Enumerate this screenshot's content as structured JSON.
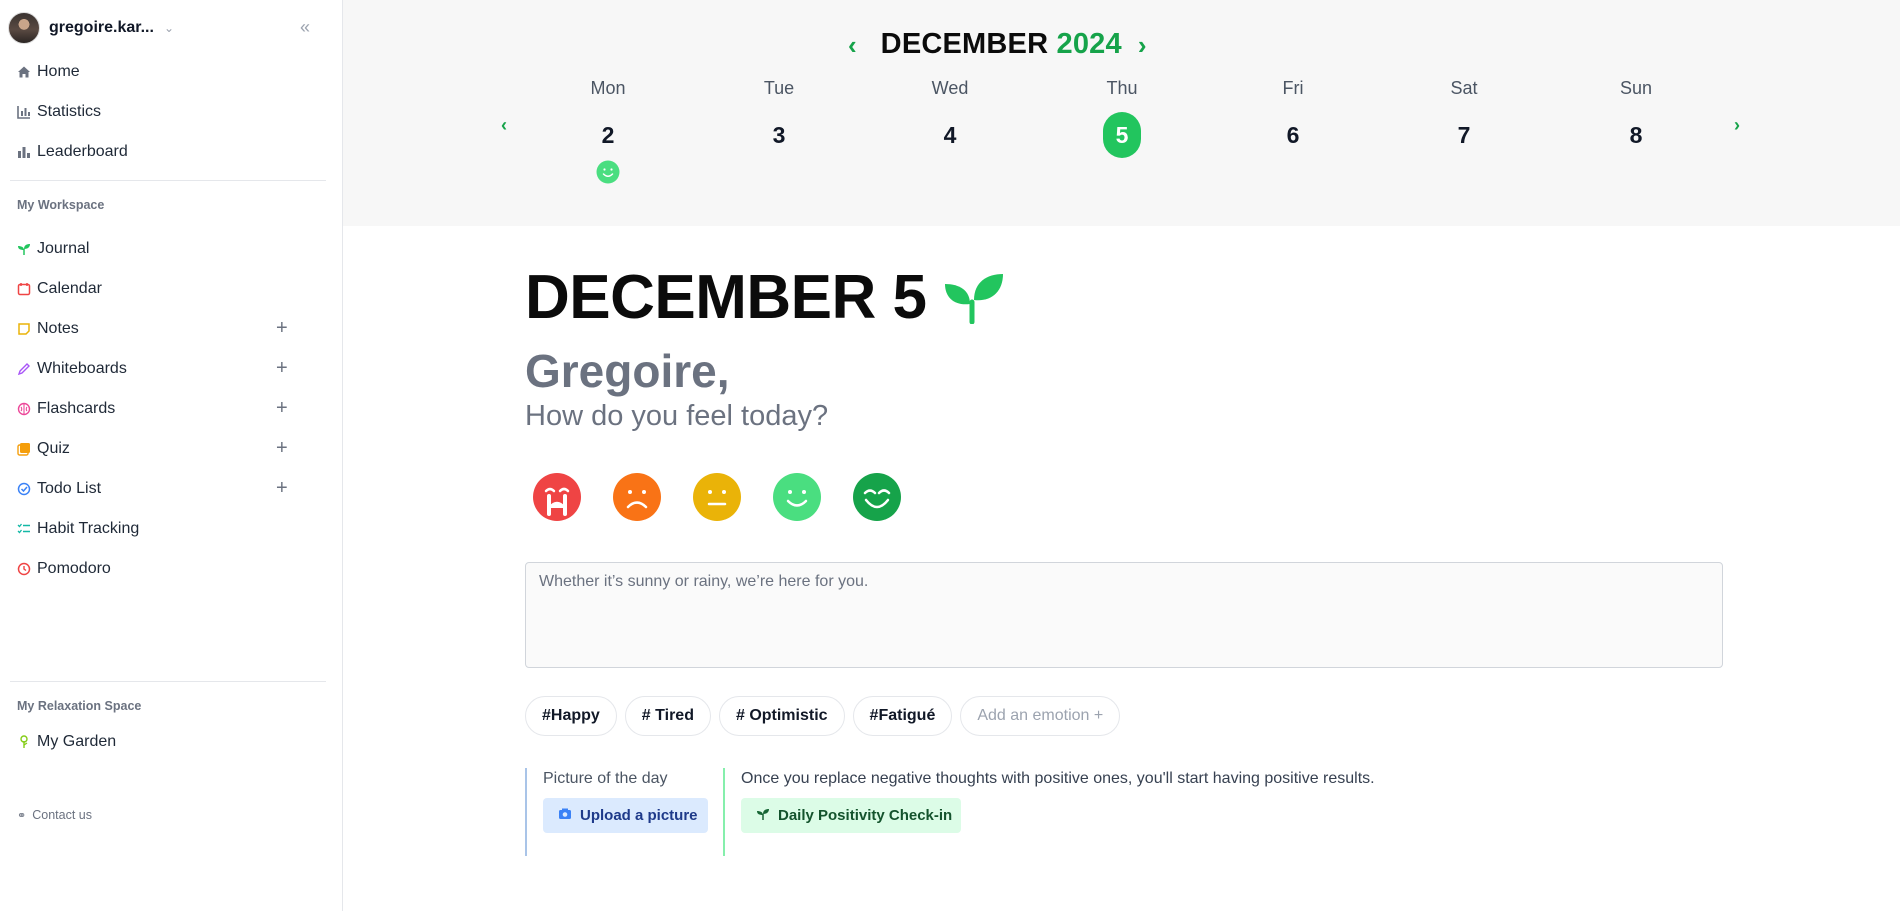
{
  "user": {
    "name": "gregoire.kar..."
  },
  "sidebar": {
    "main_items": [
      {
        "label": "Home",
        "icon": "home-icon"
      },
      {
        "label": "Statistics",
        "icon": "chart-icon"
      },
      {
        "label": "Leaderboard",
        "icon": "podium-icon"
      }
    ],
    "workspace_label": "My Workspace",
    "workspace_items": [
      {
        "label": "Journal",
        "icon": "sprout-icon",
        "color": "#22c55e"
      },
      {
        "label": "Calendar",
        "icon": "calendar-icon",
        "color": "#ef4444"
      },
      {
        "label": "Notes",
        "icon": "note-icon",
        "color": "#eab308"
      },
      {
        "label": "Whiteboards",
        "icon": "pencil-icon",
        "color": "#a855f7"
      },
      {
        "label": "Flashcards",
        "icon": "brain-icon",
        "color": "#ec4899"
      },
      {
        "label": "Quiz",
        "icon": "quiz-icon",
        "color": "#f59e0b"
      },
      {
        "label": "Todo List",
        "icon": "check-circle-icon",
        "color": "#3b82f6"
      },
      {
        "label": "Habit Tracking",
        "icon": "checklist-icon",
        "color": "#14b8a6"
      },
      {
        "label": "Pomodoro",
        "icon": "clock-icon",
        "color": "#ef4444"
      }
    ],
    "relax_label": "My Relaxation Space",
    "relax_items": [
      {
        "label": "My Garden",
        "icon": "plant-icon",
        "color": "#84cc16"
      }
    ],
    "contact_label": "Contact us"
  },
  "calendar": {
    "month": "DECEMBER",
    "year": "2024",
    "days": [
      {
        "name": "Mon",
        "num": "2",
        "mood": "happy"
      },
      {
        "name": "Tue",
        "num": "3"
      },
      {
        "name": "Wed",
        "num": "4"
      },
      {
        "name": "Thu",
        "num": "5",
        "today": true
      },
      {
        "name": "Fri",
        "num": "6"
      },
      {
        "name": "Sat",
        "num": "7"
      },
      {
        "name": "Sun",
        "num": "8"
      }
    ]
  },
  "main": {
    "headline": "DECEMBER 5",
    "greeting": "Gregoire,",
    "question": "How do you feel today?",
    "moods": [
      {
        "name": "crying",
        "color": "#ef4444"
      },
      {
        "name": "sad",
        "color": "#f97316"
      },
      {
        "name": "neutral",
        "color": "#eab308"
      },
      {
        "name": "happy",
        "color": "#4ade80"
      },
      {
        "name": "very-happy",
        "color": "#16a34a"
      }
    ],
    "placeholder": "Whether it’s sunny or rainy, we’re here for you.",
    "tags": [
      "#Happy",
      "# Tired",
      "# Optimistic",
      "#Fatigué"
    ],
    "add_emotion": "Add an emotion +",
    "picture_label": "Picture of the day",
    "upload_label": "Upload a picture",
    "quote": "Once you replace negative thoughts with positive ones, you'll start having positive results.",
    "checkin_label": "Daily Positivity Check-in"
  },
  "colors": {
    "accent": "#16a34a",
    "today": "#22c55e"
  }
}
